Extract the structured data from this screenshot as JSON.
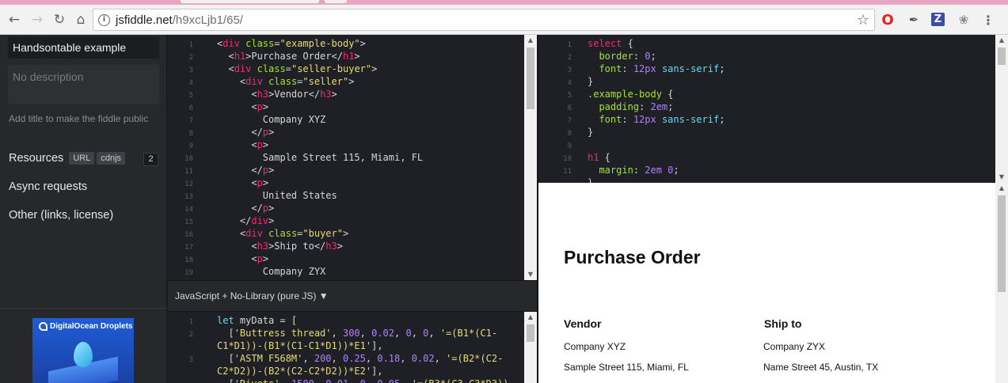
{
  "browser": {
    "url_host": "jsfiddle.net",
    "url_path": "/h9xcLjb1/65/"
  },
  "sidebar": {
    "title_value": "Handsontable example",
    "description_placeholder": "No description",
    "hint": "Add title to make the fiddle public",
    "resources_label": "Resources",
    "resources_chips": [
      "URL",
      "cdnjs"
    ],
    "resources_count": "2",
    "async_label": "Async requests",
    "other_label": "Other (links, license)",
    "ad_text": "DigitalOcean Droplets"
  },
  "html_editor": {
    "line_numbers": [
      "1",
      "2",
      "3",
      "4",
      "5",
      "6",
      "7",
      "8",
      "9",
      "10",
      "11",
      "12",
      "13",
      "14",
      "15",
      "16",
      "17",
      "18",
      "19"
    ]
  },
  "css_editor": {
    "line_numbers": [
      "1",
      "2",
      "3",
      "4",
      "5",
      "6",
      "7",
      "8",
      "9",
      "10",
      "11"
    ]
  },
  "js_panel": {
    "language_label": "JavaScript + No-Library (pure JS) ▼",
    "line_numbers": [
      "1",
      "2",
      "",
      "3",
      "",
      ""
    ]
  },
  "result": {
    "heading": "Purchase Order",
    "vendor_title": "Vendor",
    "vendor_company": "Company XYZ",
    "vendor_address": "Sample Street 115, Miami, FL",
    "buyer_title": "Ship to",
    "buyer_company": "Company ZYX",
    "buyer_address": "Name Street 45, Austin, TX"
  },
  "colors": {
    "tabstrip": "#e8a6c2",
    "editor_bg": "#1f2025",
    "sidebar_bg": "#27282b",
    "tag": "#f92672",
    "attr": "#a6e22e",
    "string": "#e6db74"
  }
}
